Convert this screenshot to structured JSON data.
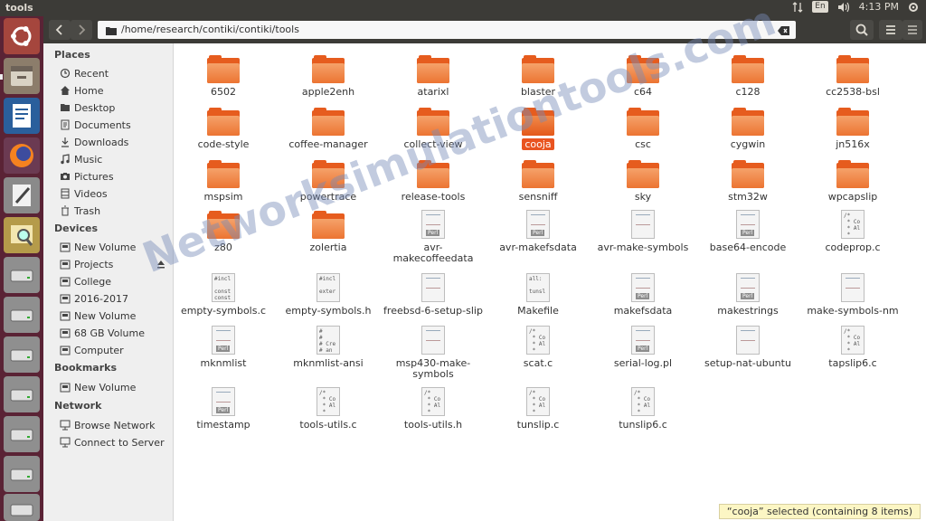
{
  "window": {
    "title": "tools"
  },
  "tray": {
    "keyboard": "En",
    "time": "4:13 PM"
  },
  "pathbar": {
    "path": "/home/research/contiki/contiki/tools"
  },
  "sidebar": {
    "places_heading": "Places",
    "places": [
      "Recent",
      "Home",
      "Desktop",
      "Documents",
      "Downloads",
      "Music",
      "Pictures",
      "Videos",
      "Trash"
    ],
    "devices_heading": "Devices",
    "devices": [
      "New Volume",
      "Projects",
      "College",
      "2016-2017",
      "New Volume",
      "68 GB Volume",
      "Computer"
    ],
    "bookmarks_heading": "Bookmarks",
    "bookmarks": [
      "New Volume"
    ],
    "network_heading": "Network",
    "network": [
      "Browse Network",
      "Connect to Server"
    ]
  },
  "items": [
    {
      "name": "6502",
      "type": "folder"
    },
    {
      "name": "apple2enh",
      "type": "folder"
    },
    {
      "name": "atarixl",
      "type": "folder"
    },
    {
      "name": "blaster",
      "type": "folder"
    },
    {
      "name": "c64",
      "type": "folder"
    },
    {
      "name": "c128",
      "type": "folder"
    },
    {
      "name": "cc2538-bsl",
      "type": "folder"
    },
    {
      "name": "code-style",
      "type": "folder"
    },
    {
      "name": "coffee-manager",
      "type": "folder"
    },
    {
      "name": "collect-view",
      "type": "folder"
    },
    {
      "name": "cooja",
      "type": "folder",
      "selected": true
    },
    {
      "name": "csc",
      "type": "folder"
    },
    {
      "name": "cygwin",
      "type": "folder"
    },
    {
      "name": "jn516x",
      "type": "folder"
    },
    {
      "name": "mspsim",
      "type": "folder"
    },
    {
      "name": "powertrace",
      "type": "folder"
    },
    {
      "name": "release-tools",
      "type": "folder"
    },
    {
      "name": "sensniff",
      "type": "folder"
    },
    {
      "name": "sky",
      "type": "folder"
    },
    {
      "name": "stm32w",
      "type": "folder"
    },
    {
      "name": "wpcapslip",
      "type": "folder"
    },
    {
      "name": "z80",
      "type": "folder"
    },
    {
      "name": "zolertia",
      "type": "folder"
    },
    {
      "name": "avr-\nmakecoffeedata",
      "type": "perl"
    },
    {
      "name": "avr-makefsdata",
      "type": "perl"
    },
    {
      "name": "avr-make-symbols",
      "type": "script"
    },
    {
      "name": "base64-encode",
      "type": "perl"
    },
    {
      "name": "codeprop.c",
      "type": "c"
    },
    {
      "name": "empty-symbols.c",
      "type": "code",
      "preview": "#incl\n\nconst\nconst"
    },
    {
      "name": "empty-symbols.h",
      "type": "code",
      "preview": "#incl\n\nexter"
    },
    {
      "name": "freebsd-6-setup-slip",
      "type": "script"
    },
    {
      "name": "Makefile",
      "type": "code",
      "preview": "all:\n\ntunsl"
    },
    {
      "name": "makefsdata",
      "type": "perl"
    },
    {
      "name": "makestrings",
      "type": "perl"
    },
    {
      "name": "make-symbols-nm",
      "type": "script"
    },
    {
      "name": "mknmlist",
      "type": "perl"
    },
    {
      "name": "mknmlist-ansi",
      "type": "code",
      "preview": "#\n#\n# Cre\n# an"
    },
    {
      "name": "msp430-make-\nsymbols",
      "type": "script"
    },
    {
      "name": "scat.c",
      "type": "c"
    },
    {
      "name": "serial-log.pl",
      "type": "perl"
    },
    {
      "name": "setup-nat-ubuntu",
      "type": "script"
    },
    {
      "name": "tapslip6.c",
      "type": "c"
    },
    {
      "name": "timestamp",
      "type": "perl"
    },
    {
      "name": "tools-utils.c",
      "type": "c"
    },
    {
      "name": "tools-utils.h",
      "type": "c"
    },
    {
      "name": "tunslip.c",
      "type": "c"
    },
    {
      "name": "tunslip6.c",
      "type": "c"
    }
  ],
  "file_badges": {
    "perl": "Perl"
  },
  "c_preview": "/*\n * Co\n * Al\n *",
  "status": "“cooja” selected  (containing 8 items)",
  "watermark": "Networksimulationtools.com",
  "colors": {
    "accent": "#e95420",
    "folder": "#ec7432",
    "launcher": "#5a2335",
    "panel": "#3c3b37"
  }
}
